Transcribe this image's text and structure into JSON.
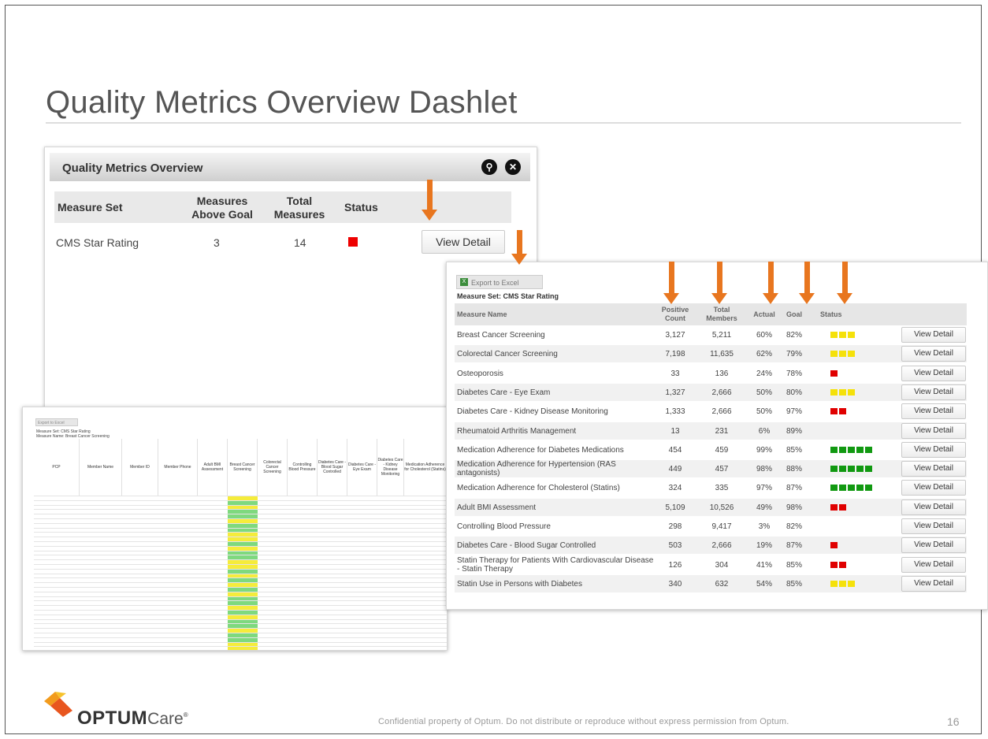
{
  "slide": {
    "title": "Quality Metrics Overview Dashlet",
    "footer": "Confidential property of Optum. Do not distribute or reproduce without express permission from Optum.",
    "page_number": "16",
    "logo_optum": "OPTUM",
    "logo_care": "Care"
  },
  "overview": {
    "title": "Quality Metrics Overview",
    "headers": {
      "measure_set": "Measure Set",
      "above_goal": "Measures Above Goal",
      "total": "Total Measures",
      "status": "Status"
    },
    "row": {
      "measure_set": "CMS Star Rating",
      "above_goal": "3",
      "total": "14",
      "status_color": "#e00000"
    },
    "view_detail": "View Detail"
  },
  "detail": {
    "export_label": "Export to Excel",
    "measure_set_label": "Measure Set: CMS Star Rating",
    "headers": {
      "name": "Measure Name",
      "positive": "Positive Count",
      "total": "Total Members",
      "actual": "Actual",
      "goal": "Goal",
      "status": "Status"
    },
    "view_detail": "View Detail",
    "rows": [
      {
        "name": "Breast Cancer Screening",
        "positive": "3,127",
        "total": "5,211",
        "actual": "60%",
        "goal": "82%",
        "status": [
          "yellow",
          "yellow",
          "yellow"
        ]
      },
      {
        "name": "Colorectal Cancer Screening",
        "positive": "7,198",
        "total": "11,635",
        "actual": "62%",
        "goal": "79%",
        "status": [
          "yellow",
          "yellow",
          "yellow"
        ]
      },
      {
        "name": "Osteoporosis",
        "positive": "33",
        "total": "136",
        "actual": "24%",
        "goal": "78%",
        "status": [
          "red"
        ]
      },
      {
        "name": "Diabetes Care - Eye Exam",
        "positive": "1,327",
        "total": "2,666",
        "actual": "50%",
        "goal": "80%",
        "status": [
          "yellow",
          "yellow",
          "yellow"
        ]
      },
      {
        "name": "Diabetes Care - Kidney Disease Monitoring",
        "positive": "1,333",
        "total": "2,666",
        "actual": "50%",
        "goal": "97%",
        "status": [
          "red",
          "red"
        ]
      },
      {
        "name": "Rheumatoid Arthritis Management",
        "positive": "13",
        "total": "231",
        "actual": "6%",
        "goal": "89%",
        "status": []
      },
      {
        "name": "Medication Adherence for Diabetes Medications",
        "positive": "454",
        "total": "459",
        "actual": "99%",
        "goal": "85%",
        "status": [
          "green",
          "green",
          "green",
          "green",
          "green"
        ]
      },
      {
        "name": "Medication Adherence for Hypertension (RAS antagonists)",
        "positive": "449",
        "total": "457",
        "actual": "98%",
        "goal": "88%",
        "status": [
          "green",
          "green",
          "green",
          "green",
          "green"
        ]
      },
      {
        "name": "Medication Adherence for Cholesterol (Statins)",
        "positive": "324",
        "total": "335",
        "actual": "97%",
        "goal": "87%",
        "status": [
          "green",
          "green",
          "green",
          "green",
          "green"
        ]
      },
      {
        "name": "Adult BMI Assessment",
        "positive": "5,109",
        "total": "10,526",
        "actual": "49%",
        "goal": "98%",
        "status": [
          "red",
          "red"
        ]
      },
      {
        "name": "Controlling Blood Pressure",
        "positive": "298",
        "total": "9,417",
        "actual": "3%",
        "goal": "82%",
        "status": []
      },
      {
        "name": "Diabetes Care - Blood Sugar Controlled",
        "positive": "503",
        "total": "2,666",
        "actual": "19%",
        "goal": "87%",
        "status": [
          "red"
        ]
      },
      {
        "name": "Statin Therapy for Patients With Cardiovascular Disease - Statin Therapy",
        "positive": "126",
        "total": "304",
        "actual": "41%",
        "goal": "85%",
        "status": [
          "red",
          "red"
        ]
      },
      {
        "name": "Statin Use in Persons with Diabetes",
        "positive": "340",
        "total": "632",
        "actual": "54%",
        "goal": "85%",
        "status": [
          "yellow",
          "yellow",
          "yellow"
        ]
      }
    ]
  },
  "member_detail": {
    "export_label": "Export to Excel",
    "measure_set_label": "Measure Set: CMS Star Rating",
    "measure_name_label": "Measure Name: Breast Cancer Screening",
    "headers": [
      "PCP",
      "Member Name",
      "Member ID",
      "Member Phone",
      "Adult BMI Assessment",
      "Breast Cancer Screening",
      "Colorectal Cancer Screening",
      "Controlling Blood Pressure",
      "Diabetes Care - Blood Sugar Controlled",
      "Diabetes Care - Eye Exam",
      "Diabetes Care - Kidney Disease Monitoring",
      "Medication Adherence for Cholesterol (Statins)"
    ]
  },
  "colors": {
    "red": "#e00000",
    "yellow": "#f5e10a",
    "green": "#119911",
    "arrow": "#e8761f",
    "cell_yellow": "#f5ec3b",
    "cell_green": "#7ed97e"
  }
}
